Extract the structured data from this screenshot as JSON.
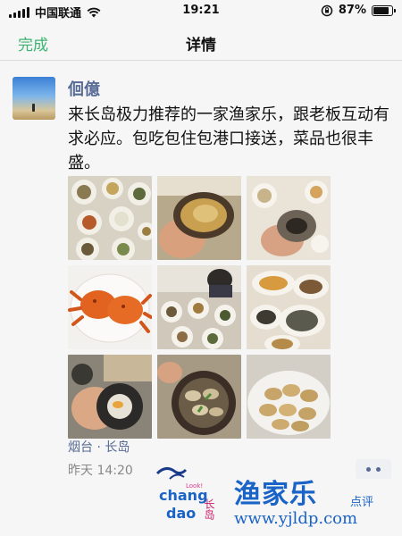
{
  "status_bar": {
    "carrier": "中国联通",
    "time": "19:21",
    "battery_text": "87%",
    "battery_level": 0.87
  },
  "nav": {
    "done_label": "完成",
    "title": "详情",
    "accent_color": "#3cb371"
  },
  "post": {
    "author": "佪億",
    "text": "来长岛极力推荐的一家渔家乐，跟老板互动有求必应。包吃包住包港口接送，菜品也很丰盛。",
    "photos": [
      {
        "name": "photo-seafood-table-1"
      },
      {
        "name": "photo-abalone-in-hand"
      },
      {
        "name": "photo-conch-in-hand"
      },
      {
        "name": "photo-red-crabs"
      },
      {
        "name": "photo-dinner-table-people"
      },
      {
        "name": "photo-seafood-dishes"
      },
      {
        "name": "photo-sea-urchin"
      },
      {
        "name": "photo-clams-bowl"
      },
      {
        "name": "photo-razor-clams-plate"
      }
    ],
    "location": "烟台 · 长岛",
    "time": "昨天 14:20",
    "link_color": "#576b95"
  },
  "watermark": {
    "brand": "渔家乐",
    "brand_sub": "点评",
    "url": "www.yjldp.com",
    "logo_text_1": "chang",
    "logo_text_2": "dao",
    "logo_look": "Look!",
    "logo_cn": "长岛"
  }
}
